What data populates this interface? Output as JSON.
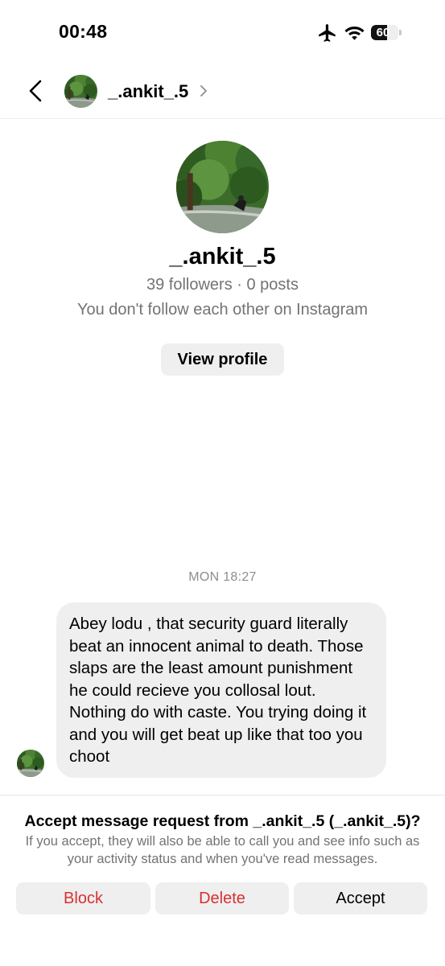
{
  "status_bar": {
    "time": "00:48",
    "icons": [
      "airplane-icon",
      "wifi-icon",
      "battery-icon"
    ],
    "battery_level": "60"
  },
  "header": {
    "username": "_.ankit_.5",
    "back_icon": "chevron-left-icon",
    "chevron_icon": "chevron-right-icon"
  },
  "profile": {
    "username": "_.ankit_.5",
    "meta": "39 followers · 0 posts",
    "follow_status": "You don't follow each other on Instagram",
    "view_profile_label": "View profile"
  },
  "conversation": {
    "timestamp": "MON 18:27",
    "message": "Abey lodu , that security guard literally beat an innocent animal to death. Those slaps are the least amount punishment he could recieve you collosal lout. Nothing do with caste. You trying doing it and you will get beat up like that too you choot"
  },
  "request": {
    "title": "Accept message request from _.ankit_.5 (_.ankit_.5)?",
    "description": "If you accept, they will also be able to call you and see info such as your activity status and when you've read messages.",
    "block_label": "Block",
    "delete_label": "Delete",
    "accept_label": "Accept"
  },
  "colors": {
    "danger": "#d93030",
    "secondary_text": "#737373",
    "button_bg": "#efefef",
    "bubble_bg": "#efefef"
  }
}
